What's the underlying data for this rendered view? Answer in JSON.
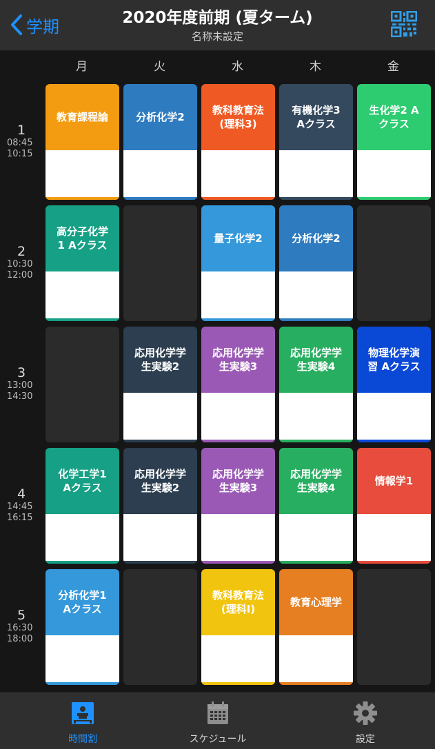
{
  "header": {
    "back_label": "学期",
    "title": "2020年度前期 (夏ターム)",
    "subtitle": "名称未設定"
  },
  "days": [
    "月",
    "火",
    "水",
    "木",
    "金"
  ],
  "periods": [
    {
      "num": "1",
      "start": "08:45",
      "end": "10:15"
    },
    {
      "num": "2",
      "start": "10:30",
      "end": "12:00"
    },
    {
      "num": "3",
      "start": "13:00",
      "end": "14:30"
    },
    {
      "num": "4",
      "start": "14:45",
      "end": "16:15"
    },
    {
      "num": "5",
      "start": "16:30",
      "end": "18:00"
    }
  ],
  "grid": [
    [
      {
        "name": "教育課程論",
        "color": "#f39c12"
      },
      {
        "name": "分析化学2",
        "color": "#2e7bbf"
      },
      {
        "name": "教科教育法\n(理科3)",
        "color": "#ef5a24"
      },
      {
        "name": "有機化学3\nAクラス",
        "color": "#34495e"
      },
      {
        "name": "生化学2 A\nクラス",
        "color": "#2ecc71"
      }
    ],
    [
      {
        "name": "高分子化学\n1 Aクラス",
        "color": "#16a085"
      },
      {
        "name": "",
        "color": ""
      },
      {
        "name": "量子化学2",
        "color": "#3498db"
      },
      {
        "name": "分析化学2",
        "color": "#2e7bbf"
      },
      {
        "name": "",
        "color": ""
      }
    ],
    [
      {
        "name": "",
        "color": ""
      },
      {
        "name": "応用化学学\n生実験2",
        "color": "#2c3e50"
      },
      {
        "name": "応用化学学\n生実験3",
        "color": "#9b59b6"
      },
      {
        "name": "応用化学学\n生実験4",
        "color": "#27ae60"
      },
      {
        "name": "物理化学演\n習 Aクラス",
        "color": "#0a48d6"
      }
    ],
    [
      {
        "name": "化学工学1\nAクラス",
        "color": "#16a085"
      },
      {
        "name": "応用化学学\n生実験2",
        "color": "#2c3e50"
      },
      {
        "name": "応用化学学\n生実験3",
        "color": "#9b59b6"
      },
      {
        "name": "応用化学学\n生実験4",
        "color": "#27ae60"
      },
      {
        "name": "情報学1",
        "color": "#e74c3c"
      }
    ],
    [
      {
        "name": "分析化学1\nAクラス",
        "color": "#3498db"
      },
      {
        "name": "",
        "color": ""
      },
      {
        "name": "教科教育法\n(理科I)",
        "color": "#f1c40f"
      },
      {
        "name": "教育心理学",
        "color": "#e67e22"
      },
      {
        "name": "",
        "color": ""
      }
    ]
  ],
  "tabs": [
    {
      "label": "時間割",
      "icon": "timetable-icon",
      "active": true
    },
    {
      "label": "スケジュール",
      "icon": "calendar-icon",
      "active": false
    },
    {
      "label": "設定",
      "icon": "gear-icon",
      "active": false
    }
  ],
  "colors": {
    "accent": "#1e90ff",
    "background": "#161616",
    "bar": "#2f2f2f",
    "empty_cell": "#2b2b2b"
  }
}
